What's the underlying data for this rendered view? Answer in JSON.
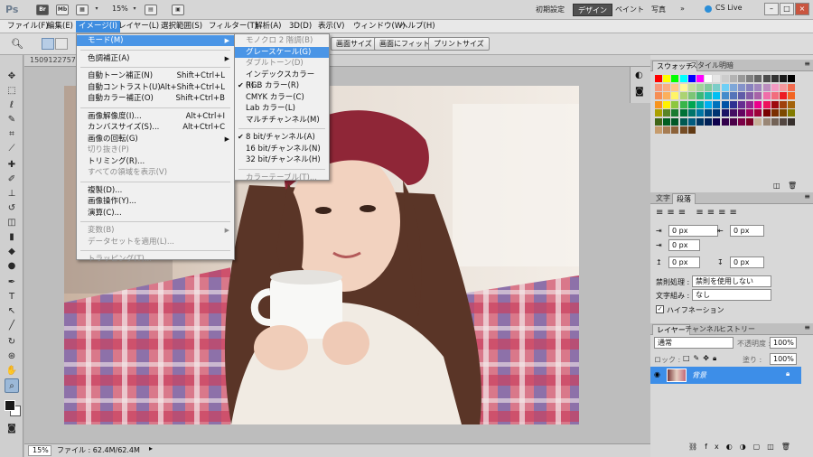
{
  "app": {
    "logo": "Ps",
    "br_label": "Br",
    "mb_label": "Mb",
    "zoom": "15%"
  },
  "workspace": [
    "初期設定",
    "デザイン",
    "ペイント",
    "写真"
  ],
  "workspace_active": "デザイン",
  "more": "»",
  "cs_live": "CS Live",
  "menubar": [
    "ファイル(F)",
    "編集(E)",
    "イメージ(I)",
    "レイヤー(L)",
    "選択範囲(S)",
    "フィルター(T)",
    "解析(A)",
    "3D(D)",
    "表示(V)",
    "ウィンドウ(W)",
    "ヘルプ(H)"
  ],
  "options": {
    "buttons": [
      "画面サイズ",
      "画面にフィット",
      "プリントサイズ"
    ]
  },
  "doc_tab": "15091227573",
  "image_menu": [
    {
      "label": "モード(M)",
      "sub": true,
      "hl": true
    },
    {
      "sep": true
    },
    {
      "label": "色調補正(A)",
      "sub": true
    },
    {
      "sep": true
    },
    {
      "label": "自動トーン補正(N)",
      "sc": "Shift+Ctrl+L"
    },
    {
      "label": "自動コントラスト(U)",
      "sc": "Alt+Shift+Ctrl+L"
    },
    {
      "label": "自動カラー補正(O)",
      "sc": "Shift+Ctrl+B"
    },
    {
      "sep": true
    },
    {
      "label": "画像解像度(I)...",
      "sc": "Alt+Ctrl+I"
    },
    {
      "label": "カンバスサイズ(S)...",
      "sc": "Alt+Ctrl+C"
    },
    {
      "label": "画像の回転(G)",
      "sub": true
    },
    {
      "label": "切り抜き(P)",
      "dis": true
    },
    {
      "label": "トリミング(R)..."
    },
    {
      "label": "すべての領域を表示(V)",
      "dis": true
    },
    {
      "sep": true
    },
    {
      "label": "複製(D)..."
    },
    {
      "label": "画像操作(Y)..."
    },
    {
      "label": "演算(C)..."
    },
    {
      "sep": true
    },
    {
      "label": "変数(B)",
      "sub": true,
      "dis": true
    },
    {
      "label": "データセットを適用(L)...",
      "dis": true
    },
    {
      "sep": true
    },
    {
      "label": "トラッピング(T)...",
      "dis": true
    }
  ],
  "mode_menu": [
    {
      "label": "モノクロ 2 階調(B)",
      "dis": true
    },
    {
      "label": "グレースケール(G)",
      "hl": true
    },
    {
      "label": "ダブルトーン(D)",
      "dis": true
    },
    {
      "label": "インデックスカラー(I)..."
    },
    {
      "label": "RGB カラー(R)",
      "check": true
    },
    {
      "label": "CMYK カラー(C)"
    },
    {
      "label": "Lab カラー(L)"
    },
    {
      "label": "マルチチャンネル(M)"
    },
    {
      "sep": true
    },
    {
      "label": "8 bit/チャンネル(A)",
      "check": true
    },
    {
      "label": "16 bit/チャンネル(N)"
    },
    {
      "label": "32 bit/チャンネル(H)"
    },
    {
      "sep": true
    },
    {
      "label": "カラーテーブル(T)...",
      "dis": true
    }
  ],
  "status": {
    "zoom": "15%",
    "file": "ファイル : 62.4M/62.4M"
  },
  "swatch_tabs": [
    "スウォッチ",
    "スタイル",
    "明暗"
  ],
  "swatch_colors": [
    "#ff0000",
    "#ffff00",
    "#00ff00",
    "#00ffff",
    "#0000ff",
    "#ff00ff",
    "#ffffff",
    "#e6e6e6",
    "#cccccc",
    "#b3b3b3",
    "#999999",
    "#808080",
    "#666666",
    "#4d4d4d",
    "#333333",
    "#1a1a1a",
    "#000000",
    "#f7977a",
    "#f9ad81",
    "#fdc68a",
    "#fff79a",
    "#c4df9b",
    "#a2d39c",
    "#82ca9d",
    "#7bcdc8",
    "#6ecff6",
    "#7ea7d8",
    "#8493ca",
    "#8882be",
    "#a187be",
    "#bc8dbf",
    "#f49ac2",
    "#f6989d",
    "#f26c4f",
    "#f68e55",
    "#fbaf5c",
    "#fff467",
    "#acd372",
    "#7cc576",
    "#3bb878",
    "#1abbb4",
    "#00bff3",
    "#438ccb",
    "#5574b9",
    "#605ca8",
    "#855fa8",
    "#a763a8",
    "#f06ea9",
    "#f26d7d",
    "#ed1c24",
    "#f26522",
    "#f7941d",
    "#fff200",
    "#8dc73f",
    "#39b54a",
    "#00a651",
    "#00a99d",
    "#00aeef",
    "#0072bc",
    "#0054a6",
    "#2e3192",
    "#662d91",
    "#92278f",
    "#ec008c",
    "#ed145b",
    "#9e0b0f",
    "#a0410d",
    "#a3620a",
    "#aba000",
    "#598527",
    "#197b30",
    "#007236",
    "#00746b",
    "#0076a3",
    "#004a80",
    "#003471",
    "#1b1464",
    "#440e62",
    "#630460",
    "#9e005d",
    "#9e0039",
    "#790000",
    "#7b2e00",
    "#7d4900",
    "#827b00",
    "#406618",
    "#005e20",
    "#005826",
    "#005952",
    "#005b7f",
    "#003663",
    "#002157",
    "#0d004c",
    "#32004b",
    "#4b0049",
    "#7b0046",
    "#7a0026",
    "#c7b299",
    "#998675",
    "#736357",
    "#534741",
    "#37302d",
    "#c69c6d",
    "#a67c52",
    "#8c6239",
    "#754c24",
    "#603913"
  ],
  "para_tabs": [
    "文字",
    "段落"
  ],
  "para": {
    "fields": [
      "0 px",
      "0 px",
      "0 px",
      "0 px",
      "0 px"
    ],
    "kinsoku_label": "禁則処理 :",
    "kinsoku_value": "禁則を使用しない",
    "mojigumi_label": "文字組み :",
    "mojigumi_value": "なし",
    "hyphen": "ハイフネーション"
  },
  "layers_tabs": [
    "レイヤー",
    "チャンネル",
    "ヒストリー"
  ],
  "layers": {
    "blend": "通常",
    "opacity_label": "不透明度 :",
    "opacity": "100%",
    "lock_label": "ロック :",
    "fill_label": "塗り :",
    "fill": "100%",
    "layer_name": "背景"
  }
}
